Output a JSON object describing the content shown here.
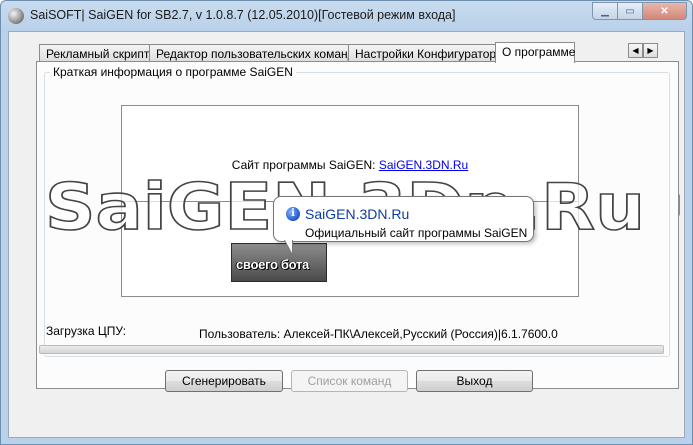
{
  "window": {
    "title": "SaiSOFT| SaiGEN for SB2.7, v 1.0.8.7 (12.05.2010)[Гостевой режим входа]"
  },
  "tabs": [
    {
      "label": "Рекламный скрипт"
    },
    {
      "label": "Редактор пользовательских команд"
    },
    {
      "label": "Настройки Конфигуратора"
    },
    {
      "label": "О программе"
    }
  ],
  "about": {
    "group_title": "Краткая информация о программе SaiGEN",
    "site_label": "Сайт программы SaiGEN:",
    "site_link": "SaiGEN.3DN.Ru"
  },
  "status": {
    "cpu_label": "Загрузка ЦПУ:",
    "user_line": "Пользователь: Алексей-ПК\\Алексей,Русский (Россия)|6.1.7600.0",
    "cpu_progress": 0
  },
  "buttons": {
    "generate": "Сгенерировать",
    "command_list": "Список команд",
    "exit": "Выход"
  },
  "tooltip": {
    "title": "SaiGEN.3DN.Ru",
    "subtitle": "Официальный сайт программы SaiGEN"
  },
  "overlay": {
    "watermark": "SaiGEN.3Dn.Ru",
    "banner": "своего бота"
  },
  "icons": {
    "tab_left": "chevron-left-icon",
    "tab_right": "chevron-right-icon",
    "side_arrow": "chevron-right-icon",
    "info": "info-icon"
  },
  "colors": {
    "titlebar": "#b9d1ea",
    "close_button": "#d2887a",
    "link": "#0000ee"
  }
}
